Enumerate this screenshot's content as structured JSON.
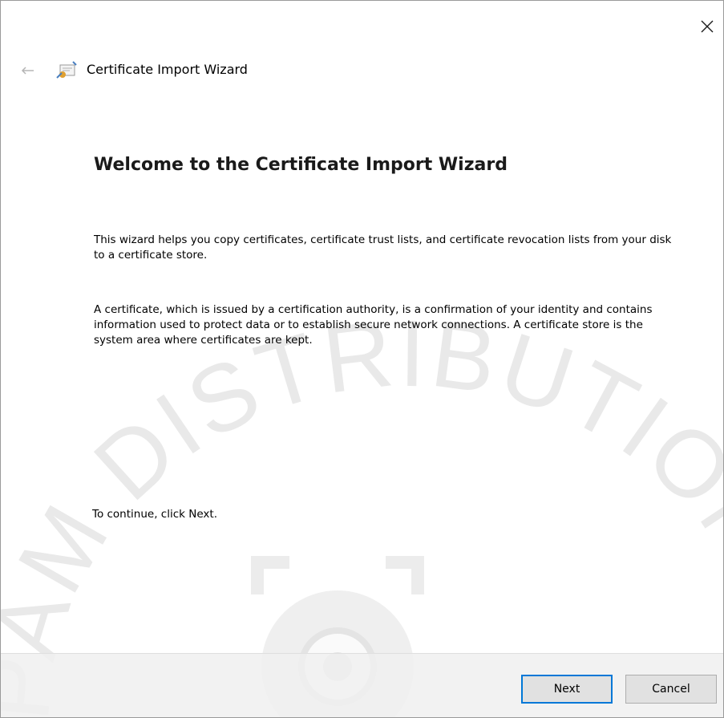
{
  "wizard": {
    "title": "Certificate Import Wizard",
    "back_icon": "back-arrow-icon",
    "app_icon": "certificate-icon",
    "close_icon": "close-icon"
  },
  "content": {
    "heading": "Welcome to the Certificate Import Wizard",
    "paragraph_1": "This wizard helps you copy certificates, certificate trust lists, and certificate revocation lists from your disk to a certificate store.",
    "paragraph_2": "A certificate, which is issued by a certification authority, is a confirmation of your identity and contains information used to protect data or to establish secure network connections. A certificate store is the system area where certificates are kept.",
    "continue_hint": "To continue, click Next."
  },
  "footer": {
    "next_label": "Next",
    "cancel_label": "Cancel"
  },
  "watermark": {
    "text": "PAM DISTRIBUTION",
    "color": "#e6e6e6"
  },
  "colors": {
    "accent": "#0078d7",
    "button_bg": "#e1e1e1",
    "footer_bg": "#f0f0f0"
  }
}
